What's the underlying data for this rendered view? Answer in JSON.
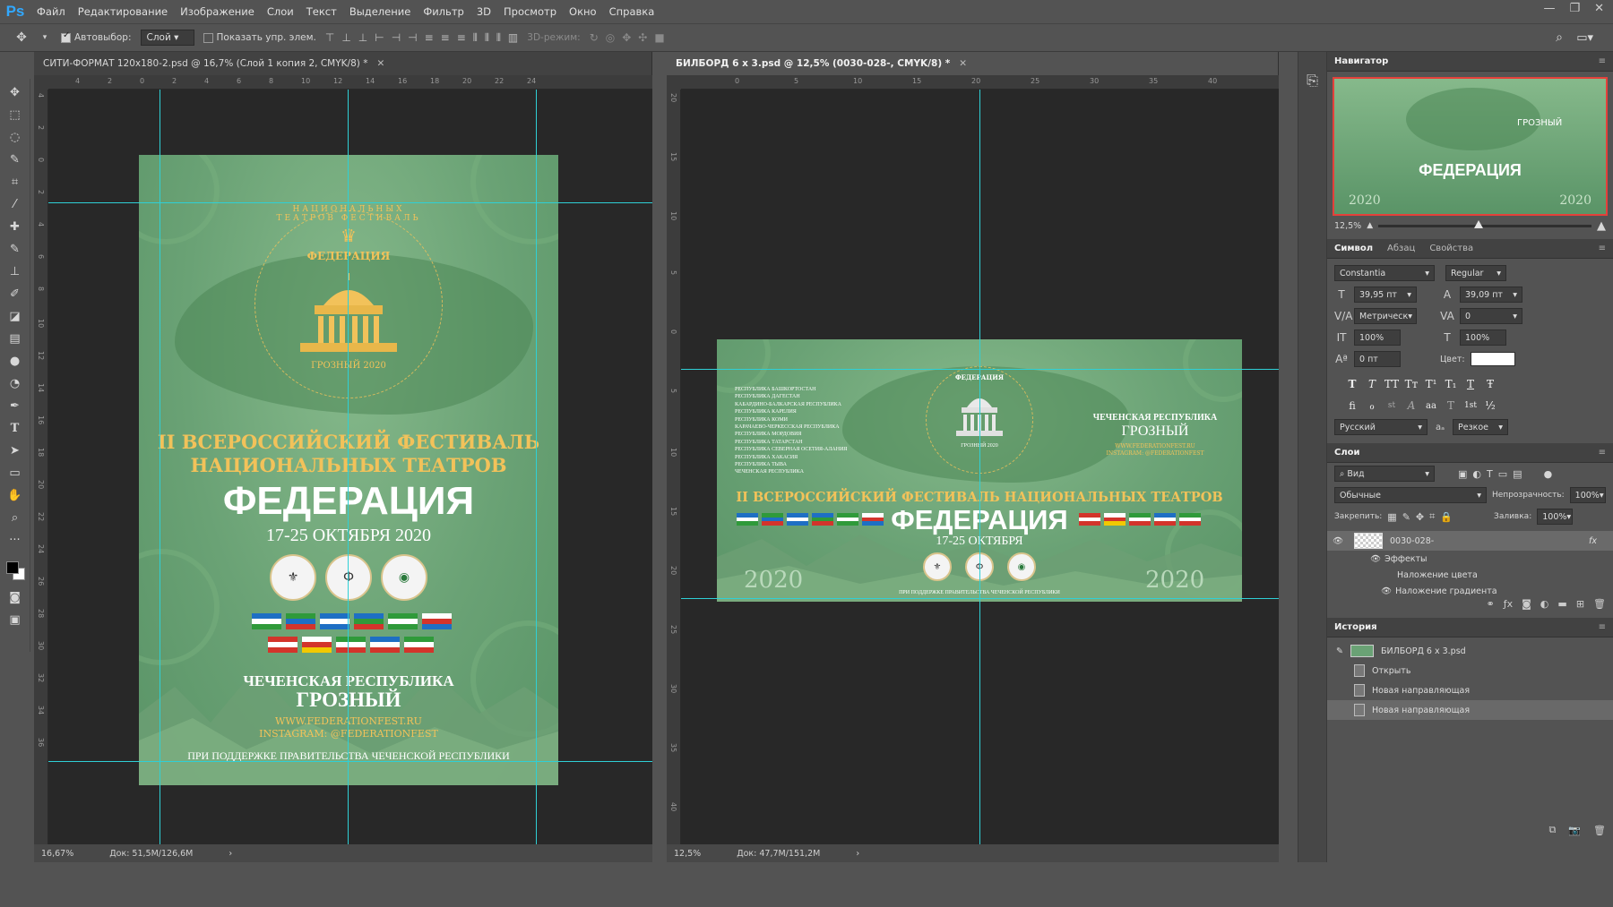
{
  "app": {
    "logo": "Ps"
  },
  "menu": [
    "Файл",
    "Редактирование",
    "Изображение",
    "Слои",
    "Текст",
    "Выделение",
    "Фильтр",
    "3D",
    "Просмотр",
    "Окно",
    "Справка"
  ],
  "window_controls": [
    "—",
    "❐",
    "✕"
  ],
  "options": {
    "autoselect_label": "Автовыбор:",
    "autoselect_checked": true,
    "autoselect_value": "Слой",
    "show_controls_label": "Показать упр. элем.",
    "show_controls_checked": false,
    "mode3d_label": "3D-режим:"
  },
  "documents": [
    {
      "tab": "СИТИ-ФОРМАТ 120х180-2.psd @ 16,7% (Слой 1 копия 2, CMYK/8) *",
      "active": false,
      "zoom": "16,67%",
      "doc_size": "Док: 51,5M/126,6M",
      "ruler_h": [
        "4",
        "2",
        "0",
        "2",
        "4",
        "6",
        "8",
        "10",
        "12",
        "14",
        "16",
        "18",
        "20",
        "22",
        "24"
      ],
      "ruler_v": [
        "4",
        "2",
        "0",
        "2",
        "4",
        "6",
        "8",
        "10",
        "12",
        "14",
        "16",
        "18",
        "20",
        "22",
        "24",
        "26",
        "28",
        "30",
        "32",
        "34",
        "36"
      ]
    },
    {
      "tab": "БИЛБОРД 6 х 3.psd @ 12,5% (0030-028-, CMYK/8) *",
      "active": true,
      "zoom": "12,5%",
      "doc_size": "Док: 47,7M/151,2M",
      "ruler_h": [
        "0",
        "5",
        "10",
        "15",
        "20",
        "25",
        "30",
        "35",
        "40"
      ],
      "ruler_v": [
        "20",
        "15",
        "10",
        "5",
        "0",
        "5",
        "10",
        "15",
        "20",
        "25",
        "30",
        "35",
        "40"
      ]
    }
  ],
  "poster": {
    "ring_text": "НАЦИОНАЛЬНЫХ ТЕАТРОВ ФЕСТИВАЛЬ",
    "brand_small": "ФЕДЕРАЦИЯ",
    "city_year": "ГРОЗНЫЙ 2020",
    "festival_line1": "II ВСЕРОССИЙСКИЙ ФЕСТИВАЛЬ",
    "festival_line2": "НАЦИОНАЛЬНЫХ ТЕАТРОВ",
    "title": "ФЕДЕРАЦИЯ",
    "dates": "17-25 ОКТЯБРЯ 2020",
    "republic": "ЧЕЧЕНСКАЯ РЕСПУБЛИКА",
    "city": "ГРОЗНЫЙ",
    "website": "WWW.FEDERATIONFEST.RU",
    "instagram": "INSTAGRAM: @FEDERATIONFEST",
    "support": "ПРИ ПОДДЕРЖКЕ ПРАВИТЕЛЬСТВА ЧЕЧЕНСКОЙ РЕСПУБЛИКИ"
  },
  "billboard": {
    "republics": [
      "РЕСПУБЛИКА БАШКОРТОСТАН",
      "РЕСПУБЛИКА ДАГЕСТАН",
      "КАБАРДИНО-БАЛКАРСКАЯ РЕСПУБЛИКА",
      "РЕСПУБЛИКА КАРЕЛИЯ",
      "РЕСПУБЛИКА КОМИ",
      "КАРАЧАЕВО-ЧЕРКЕССКАЯ РЕСПУБЛИКА",
      "РЕСПУБЛИКА МОРДОВИЯ",
      "РЕСПУБЛИКА ТАТАРСТАН",
      "РЕСПУБЛИКА СЕВЕРНАЯ ОСЕТИЯ-АЛАНИЯ",
      "РЕСПУБЛИКА ХАКАСИЯ",
      "РЕСПУБЛИКА ТЫВА",
      "ЧЕЧЕНСКАЯ РЕСПУБЛИКА"
    ],
    "republic": "ЧЕЧЕНСКАЯ РЕСПУБЛИКА",
    "city": "ГРОЗНЫЙ",
    "website": "WWW.FEDERATIONFEST.RU",
    "instagram": "INSTAGRAM: @FEDERATIONFEST",
    "festival_line": "II ВСЕРОССИЙСКИЙ ФЕСТИВАЛЬ НАЦИОНАЛЬНЫХ ТЕАТРОВ",
    "title": "ФЕДЕРАЦИЯ",
    "dates": "17-25 ОКТЯБРЯ",
    "year": "2020",
    "support": "ПРИ ПОДДЕРЖКЕ ПРАВИТЕЛЬСТВА ЧЕЧЕНСКОЙ РЕСПУБЛИКИ",
    "brand_small": "ФЕДЕРАЦИЯ",
    "city_year": "ГРОЗНЫЙ 2020"
  },
  "navigator": {
    "title": "Навигатор",
    "zoom": "12,5%",
    "zoom_level_fraction": 0.47,
    "preview_title": "ФЕДЕРАЦИЯ",
    "preview_city": "ГРОЗНЫЙ",
    "preview_year": "2020"
  },
  "character": {
    "tabs": [
      "Символ",
      "Абзац",
      "Свойства"
    ],
    "font": "Constantia",
    "style": "Regular",
    "size": "39,95 пт",
    "leading": "39,09 пт",
    "kerning": "Метрическ",
    "tracking": "0",
    "vscale": "100%",
    "hscale": "100%",
    "baseline": "0 пт",
    "color_label": "Цвет:",
    "color": "#ffffff",
    "type_buttons_1": [
      "T",
      "T",
      "TT",
      "Tт",
      "T¹",
      "T₁",
      "T",
      "Ŧ"
    ],
    "type_buttons_2": [
      "fi",
      "ℴ",
      "st",
      "A",
      "aa",
      "T",
      "1st",
      "½"
    ],
    "language": "Русский",
    "aa_icon": "aₐ",
    "antialias": "Резкое"
  },
  "layers": {
    "title": "Слои",
    "filter": "Вид",
    "blend": "Обычные",
    "opacity_label": "Непрозрачность:",
    "opacity": "100%",
    "lock_label": "Закрепить:",
    "fill_label": "Заливка:",
    "fill": "100%",
    "layer_name": "0030-028-",
    "fx": "fx",
    "effects_label": "Эффекты",
    "effect1": "Наложение цвета",
    "effect2": "Наложение градиента"
  },
  "history": {
    "title": "История",
    "snapshot": "БИЛБОРД 6 х 3.psd",
    "items": [
      "Открыть",
      "Новая направляющая",
      "Новая направляющая"
    ],
    "selected_index": 2
  },
  "colors": {
    "guide": "#2fd0d6",
    "gold": "#f2c25a",
    "poster_green": "#6aa275",
    "ps_blue": "#31a8ff"
  }
}
